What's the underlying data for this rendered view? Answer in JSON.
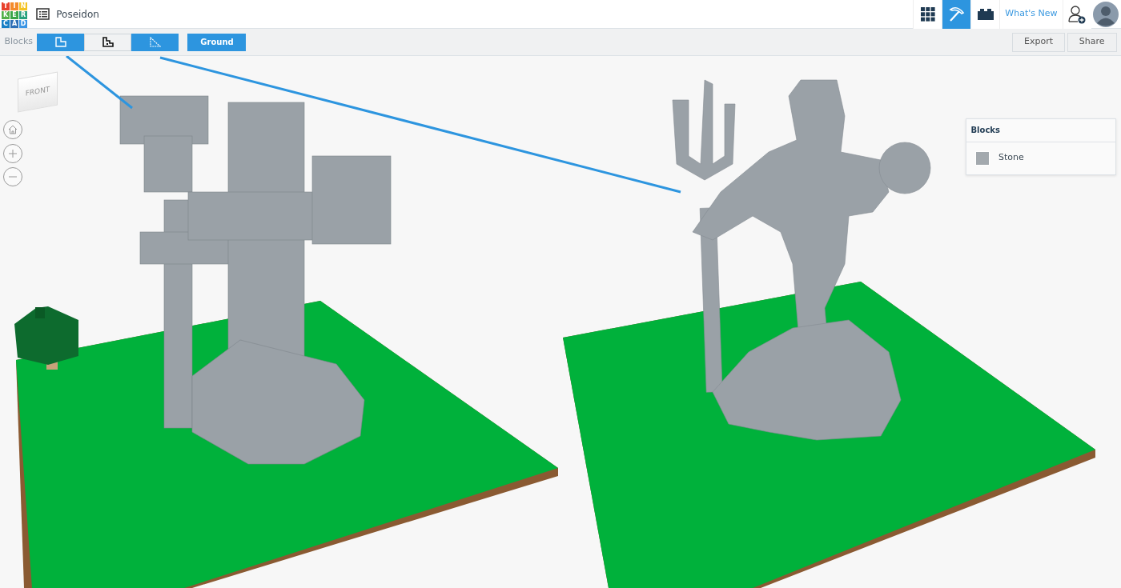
{
  "app": {
    "logo_letters": [
      "T",
      "I",
      "N",
      "K",
      "E",
      "R",
      "C",
      "A",
      "D"
    ],
    "project_title": "Poseidon"
  },
  "header_buttons": [
    {
      "kind": "grid",
      "selected": false
    },
    {
      "kind": "pickaxe",
      "selected": true
    },
    {
      "kind": "brick",
      "selected": false
    }
  ],
  "whats_new": "What's New",
  "toolbar": {
    "label": "Blocks",
    "modes": [
      {
        "kind": "blocks",
        "selected": true
      },
      {
        "kind": "stairs",
        "selected": false
      },
      {
        "kind": "slopes",
        "selected": true
      }
    ],
    "ground_button": "Ground",
    "export_button": "Export",
    "share_button": "Share"
  },
  "view_cube": {
    "face_label": "FRONT"
  },
  "panel": {
    "title": "Blocks",
    "items": [
      {
        "label": "Stone",
        "color": "#a3a9ae"
      }
    ]
  }
}
